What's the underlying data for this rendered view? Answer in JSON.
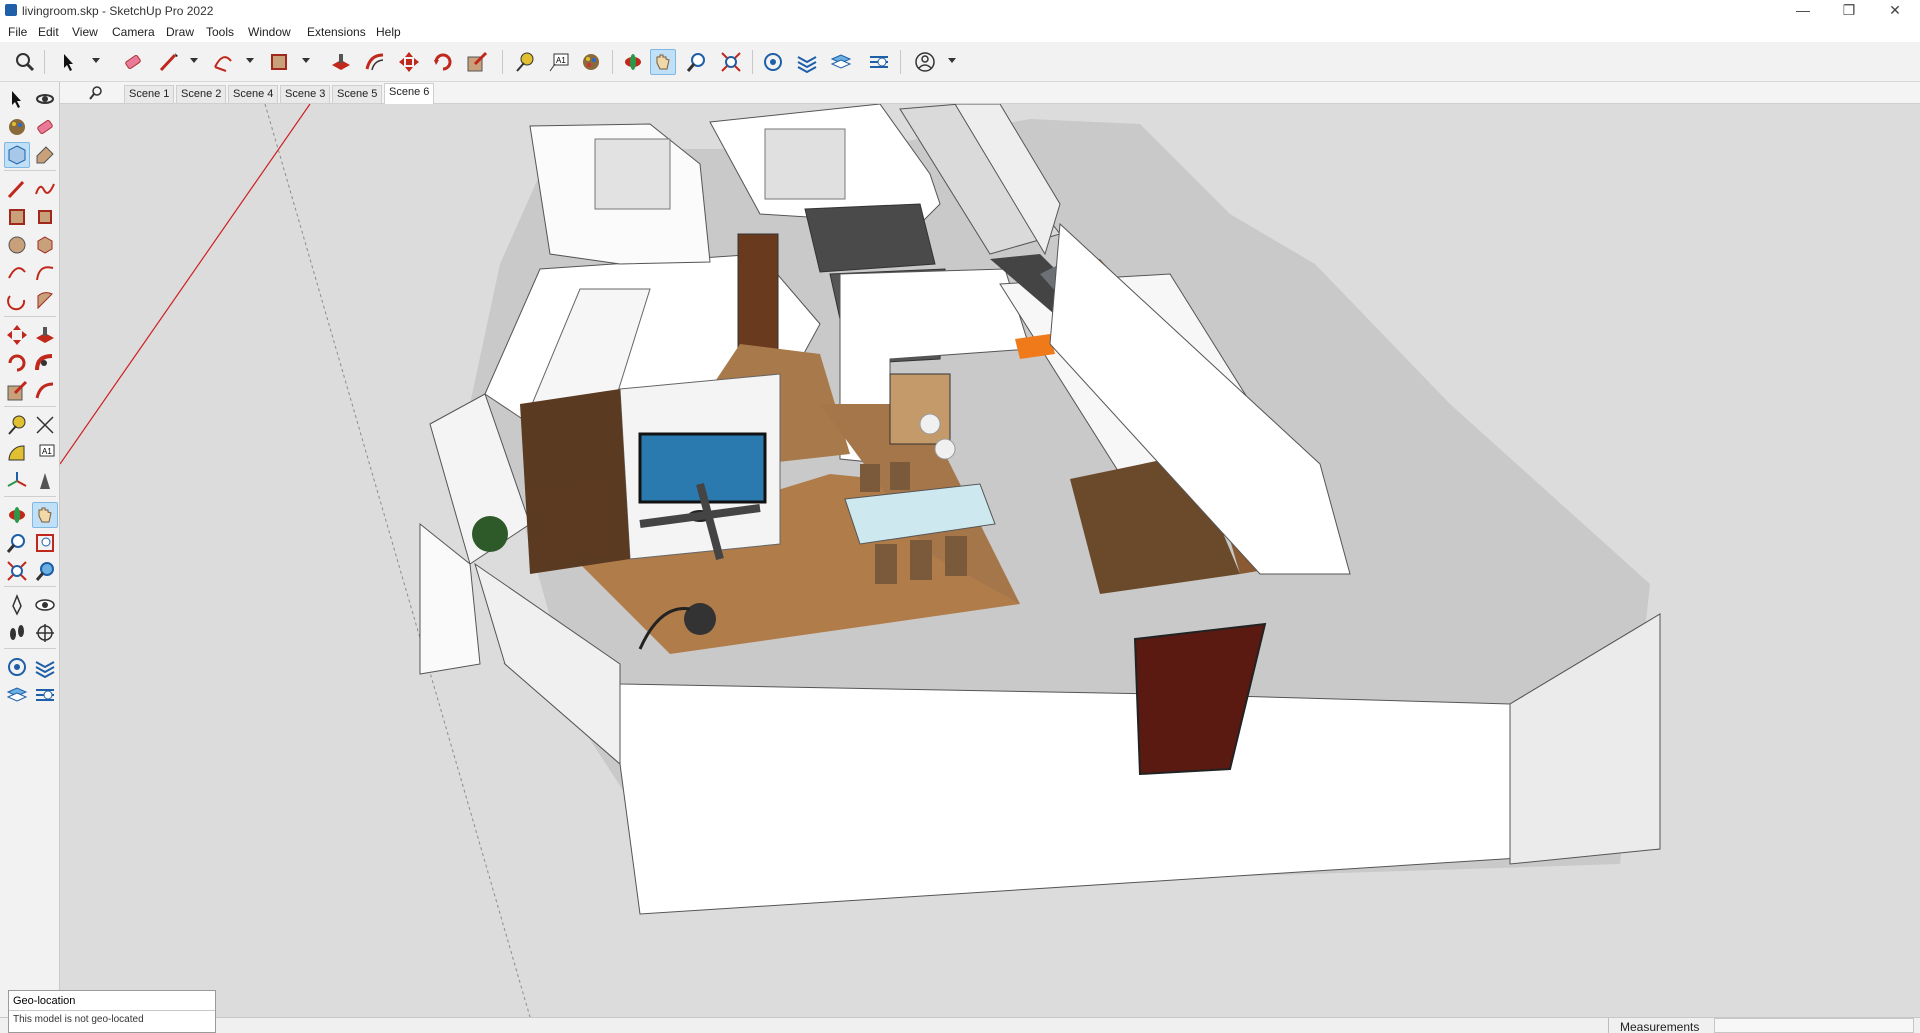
{
  "window": {
    "title": "livingroom.skp - SketchUp Pro 2022",
    "minimize_glyph": "—",
    "restore_glyph": "❐",
    "close_glyph": "✕"
  },
  "menu": [
    "File",
    "Edit",
    "View",
    "Camera",
    "Draw",
    "Tools",
    "Window",
    "Extensions",
    "Help"
  ],
  "scene_tabs": [
    "Scene 1",
    "Scene 2",
    "Scene 4",
    "Scene 3",
    "Scene 5",
    "Scene 6"
  ],
  "active_scene": "Scene 6",
  "status": {
    "geo_title": "Geo-location",
    "geo_text": "This model is not geo-located",
    "measurements_label": "Measurements",
    "measurements_value": ""
  },
  "colors": {
    "accent_selected": "#bfe0f7",
    "red_axis": "#d02020",
    "orange_counter": "#f07a1a",
    "wood": "#a8794a",
    "door": "#5a1a12"
  },
  "toolbar_icons": [
    "search-icon",
    "select-icon",
    "eraser-icon",
    "line-icon",
    "arc-icon",
    "rectangle-icon",
    "push-pull-icon",
    "offset-icon",
    "move-icon",
    "rotate-icon",
    "scale-icon",
    "tape-measure-icon",
    "text-icon",
    "paint-bucket-icon",
    "orbit-icon",
    "pan-icon",
    "zoom-icon",
    "zoom-extents-icon",
    "warehouse-icon",
    "extension-icon",
    "layers-icon",
    "sandbox-icon",
    "account-icon"
  ],
  "left_toolbar_icons": [
    "select-icon",
    "orbit-icon",
    "paint-bucket-icon",
    "eraser-icon",
    "make-component-icon",
    "tag-icon",
    "pencil-icon",
    "freehand-icon",
    "rectangle-icon",
    "rotated-rectangle-icon",
    "circle-icon",
    "polygon-icon",
    "arc-icon",
    "two-point-arc-icon",
    "three-point-arc-icon",
    "pie-icon",
    "move-icon",
    "push-pull-icon",
    "rotate-icon",
    "follow-me-icon",
    "scale-icon",
    "offset-icon",
    "tape-measure-icon",
    "dimension-icon",
    "protractor-icon",
    "text-icon",
    "axes-icon",
    "3d-text-icon",
    "orbit-icon",
    "pan-icon",
    "zoom-icon",
    "zoom-window-icon",
    "zoom-extents-icon",
    "previous-view-icon",
    "position-camera-icon",
    "look-around-icon",
    "walk-icon",
    "section-plane-icon",
    "warehouse-icon",
    "extension-icon",
    "layers-icon",
    "sandbox-icon"
  ]
}
